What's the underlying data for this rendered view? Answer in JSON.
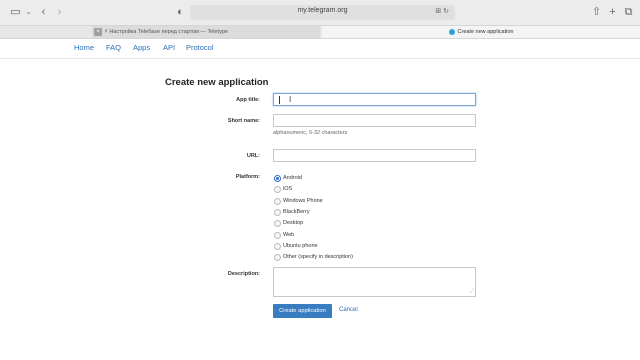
{
  "browser": {
    "url": "my.telegram.org",
    "tabs": [
      {
        "label": "⚡ Настройка Teleбase перед стартом — Teletype"
      },
      {
        "label": "Create new application"
      }
    ]
  },
  "nav": {
    "items": [
      "Home",
      "FAQ",
      "Apps",
      "API",
      "Protocol"
    ]
  },
  "form": {
    "title": "Create new application",
    "app_title_label": "App title:",
    "app_title_value": "",
    "short_name_label": "Short name:",
    "short_name_value": "",
    "short_name_hint": "alphanumeric, 5-32 characters",
    "url_label": "URL:",
    "url_value": "",
    "platform_label": "Platform:",
    "platforms": [
      {
        "label": "Android",
        "checked": true
      },
      {
        "label": "iOS",
        "checked": false
      },
      {
        "label": "Windows Phone",
        "checked": false
      },
      {
        "label": "BlackBerry",
        "checked": false
      },
      {
        "label": "Desktop",
        "checked": false
      },
      {
        "label": "Web",
        "checked": false
      },
      {
        "label": "Ubuntu phone",
        "checked": false
      },
      {
        "label": "Other (specify in description)",
        "checked": false
      }
    ],
    "description_label": "Description:",
    "create_button": "Create application",
    "cancel_link": "Cancel"
  },
  "colors": {
    "link": "#2b6fb5",
    "primary_button": "#3a7cc0",
    "radio_checked": "#2f6fcb"
  },
  "icons": [
    "sidebar-icon",
    "back-icon",
    "forward-icon",
    "shield-icon",
    "reload-icon",
    "share-icon",
    "new-tab-icon",
    "tab-overview-icon"
  ]
}
